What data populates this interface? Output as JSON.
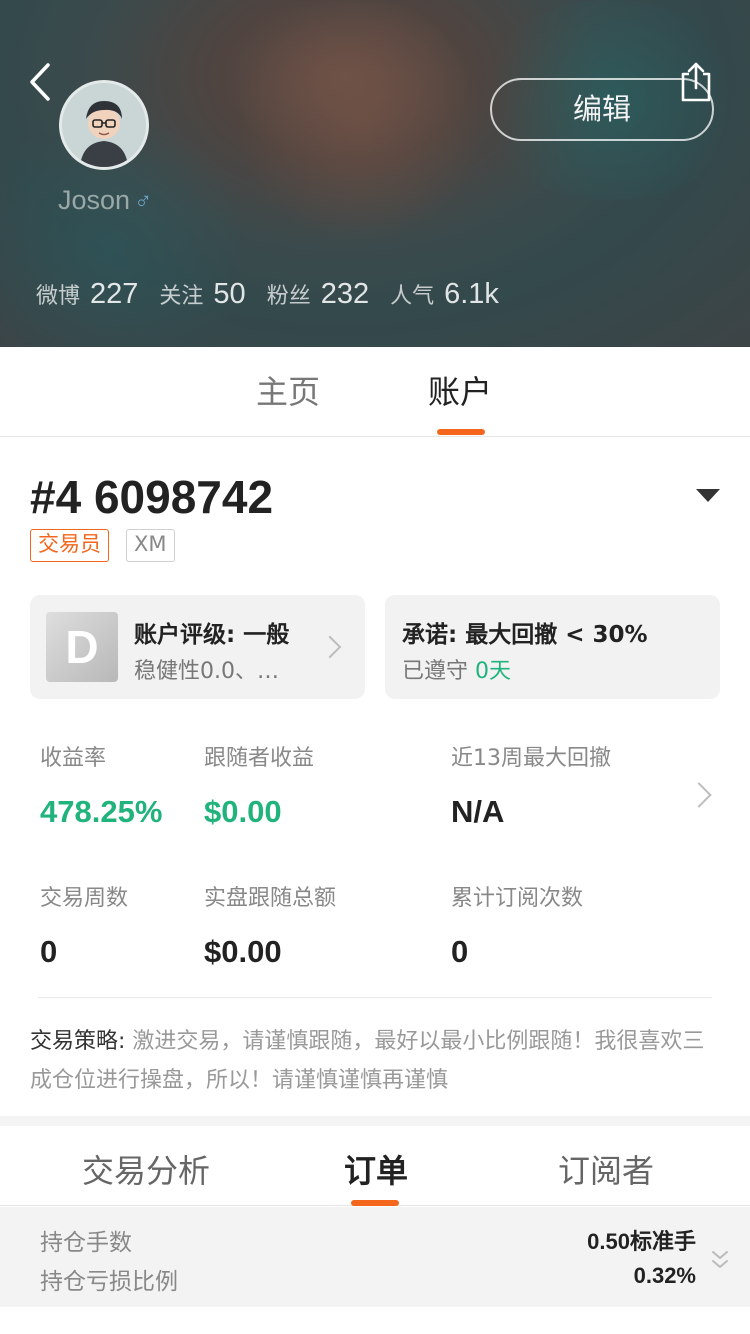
{
  "profile": {
    "username": "Joson",
    "gender_symbol": "♂",
    "edit_label": "编辑",
    "stats": [
      {
        "label": "微博",
        "value": "227"
      },
      {
        "label": "关注",
        "value": "50"
      },
      {
        "label": "粉丝",
        "value": "232"
      },
      {
        "label": "人气",
        "value": "6.1k"
      }
    ]
  },
  "main_tabs": [
    {
      "label": "主页",
      "active": false
    },
    {
      "label": "账户",
      "active": true
    }
  ],
  "account": {
    "id": "#4 6098742",
    "badges": [
      "交易员",
      "XM"
    ]
  },
  "rating_card": {
    "grade": "D",
    "title": "账户评级: 一般",
    "subtitle": "稳健性0.0、…"
  },
  "promise_card": {
    "title": "承诺: 最大回撤 < 30%",
    "subtitle_prefix": "已遵守",
    "subtitle_value": "0天"
  },
  "metrics": [
    {
      "label": "收益率",
      "value": "478.25%"
    },
    {
      "label": "跟随者收益",
      "value": "$0.00"
    },
    {
      "label": "近13周最大回撤",
      "value": "N/A"
    },
    {
      "label": "交易周数",
      "value": "0"
    },
    {
      "label": "实盘跟随总额",
      "value": "$0.00"
    },
    {
      "label": "累计订阅次数",
      "value": "0"
    }
  ],
  "strategy": {
    "label": "交易策略:",
    "text": "激进交易，请谨慎跟随，最好以最小比例跟随！我很喜欢三成仓位进行操盘，所以！请谨慎谨慎再谨慎"
  },
  "sub_tabs": [
    {
      "label": "交易分析",
      "active": false
    },
    {
      "label": "订单",
      "active": true
    },
    {
      "label": "订阅者",
      "active": false
    }
  ],
  "positions": [
    {
      "label": "持仓手数",
      "value": "0.50标准手"
    },
    {
      "label": "持仓亏损比例",
      "value": "0.32%"
    }
  ],
  "colors": {
    "accent": "#f3661b",
    "positive": "#21b37c"
  }
}
